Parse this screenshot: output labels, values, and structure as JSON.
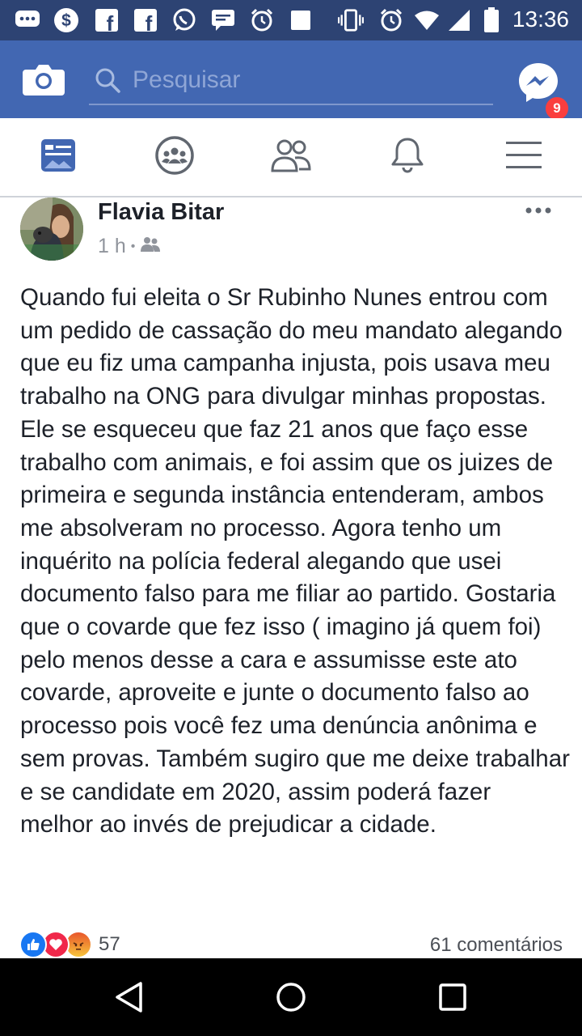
{
  "status_bar": {
    "time": "13:36",
    "icons": [
      "chat-bubble-icon",
      "dollar-icon",
      "facebook-icon",
      "facebook-icon",
      "whatsapp-icon",
      "message-icon",
      "alarm-icon",
      "square-icon",
      "vibrate-icon",
      "alarm-icon",
      "wifi-icon",
      "signal-icon",
      "battery-icon"
    ]
  },
  "app_bar": {
    "search_placeholder": "Pesquisar",
    "messenger_badge": "9"
  },
  "tabs": [
    "news-feed",
    "groups",
    "friends",
    "notifications",
    "menu"
  ],
  "post": {
    "author": "Flavia Bitar",
    "time": "1 h",
    "separator": "•",
    "body": "Quando fui eleita o Sr Rubinho Nunes entrou com um pedido de cassação do meu mandato alegando que eu fiz uma campanha injusta, pois usava meu trabalho na ONG para divulgar minhas propostas. Ele se esqueceu que faz 21 anos que faço esse trabalho com animais, e foi assim que os juizes de primeira e segunda instância entenderam, ambos me absolveram no processo. Agora tenho um  inquérito  na polícia federal alegando que usei documento falso para me filiar ao partido. Gostaria que o covarde que fez isso ( imagino já quem foi) pelo menos desse a cara e assumisse este ato covarde, aproveite e junte o documento falso ao processo pois você fez uma denúncia anônima e sem provas. Também sugiro que me deixe trabalhar e se candidate em 2020, assim poderá fazer melhor ao invés de prejudicar a cidade.",
    "reaction_count": "57",
    "comments": "61 comentários"
  },
  "colors": {
    "status_bar": "#2d4373",
    "app_bar": "#4267b2",
    "active_tab": "#4267b2",
    "inactive_tab": "#616770"
  }
}
